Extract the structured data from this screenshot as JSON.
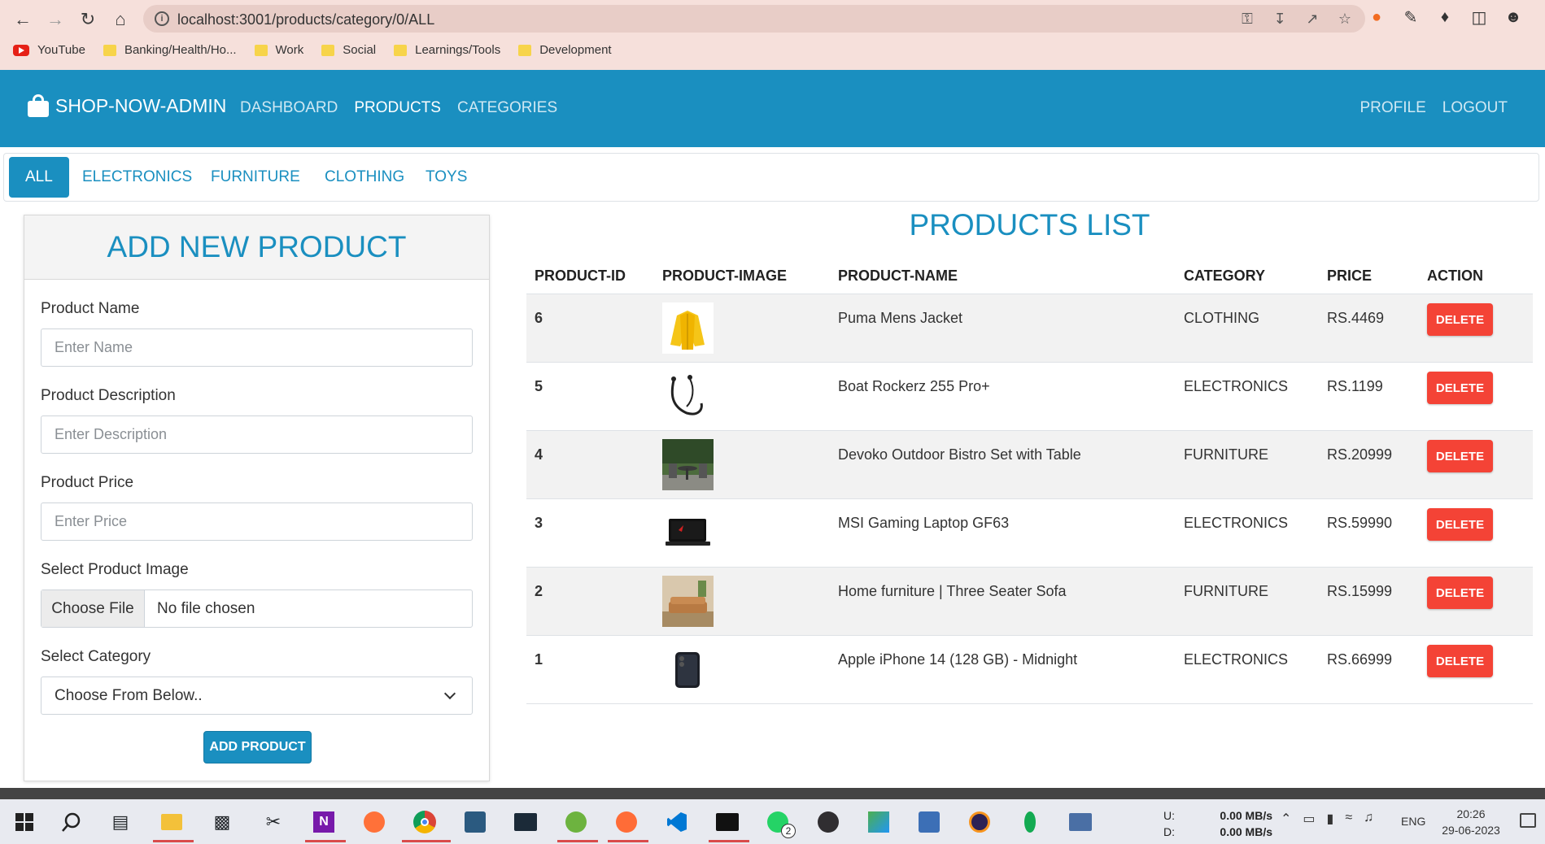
{
  "browser": {
    "url": "localhost:3001/products/category/0/ALL",
    "bookmarks": [
      {
        "label": "YouTube",
        "icon": "youtube-icon"
      },
      {
        "label": "Banking/Health/Ho...",
        "icon": "folder-icon"
      },
      {
        "label": "Work",
        "icon": "folder-icon"
      },
      {
        "label": "Social",
        "icon": "folder-icon"
      },
      {
        "label": "Learnings/Tools",
        "icon": "folder-icon"
      },
      {
        "label": "Development",
        "icon": "folder-icon"
      }
    ]
  },
  "navbar": {
    "brand": "SHOP-NOW-ADMIN",
    "links": [
      "DASHBOARD",
      "PRODUCTS",
      "CATEGORIES"
    ],
    "active_link": "PRODUCTS",
    "right_links": [
      "PROFILE",
      "LOGOUT"
    ]
  },
  "tabs": [
    "ALL",
    "ELECTRONICS",
    "FURNITURE",
    "CLOTHING",
    "TOYS"
  ],
  "form": {
    "title": "ADD NEW PRODUCT",
    "name_label": "Product Name",
    "name_placeholder": "Enter Name",
    "desc_label": "Product Description",
    "desc_placeholder": "Enter Description",
    "price_label": "Product Price",
    "price_placeholder": "Enter Price",
    "image_label": "Select Product Image",
    "file_button": "Choose File",
    "file_status": "No file chosen",
    "category_label": "Select Category",
    "category_selected": "Choose From Below..",
    "submit": "ADD PRODUCT"
  },
  "products": {
    "title": "PRODUCTS LIST",
    "columns": [
      "PRODUCT-ID",
      "PRODUCT-IMAGE",
      "PRODUCT-NAME",
      "CATEGORY",
      "PRICE",
      "ACTION"
    ],
    "rows": [
      {
        "id": "6",
        "name": "Puma Mens Jacket",
        "category": "CLOTHING",
        "price": "RS.4469",
        "action": "DELETE"
      },
      {
        "id": "5",
        "name": "Boat Rockerz 255 Pro+",
        "category": "ELECTRONICS",
        "price": "RS.1199",
        "action": "DELETE"
      },
      {
        "id": "4",
        "name": "Devoko Outdoor Bistro Set with Table",
        "category": "FURNITURE",
        "price": "RS.20999",
        "action": "DELETE"
      },
      {
        "id": "3",
        "name": "MSI Gaming Laptop GF63",
        "category": "ELECTRONICS",
        "price": "RS.59990",
        "action": "DELETE"
      },
      {
        "id": "2",
        "name": "Home furniture | Three Seater Sofa",
        "category": "FURNITURE",
        "price": "RS.15999",
        "action": "DELETE"
      },
      {
        "id": "1",
        "name": "Apple iPhone 14 (128 GB) - Midnight",
        "category": "ELECTRONICS",
        "price": "RS.66999",
        "action": "DELETE"
      }
    ]
  },
  "taskbar": {
    "net_labels": [
      "U:",
      "D:"
    ],
    "net_values": [
      "0.00 MB/s",
      "0.00 MB/s"
    ],
    "language": "ENG",
    "time": "20:26",
    "date": "29-06-2023",
    "whatsapp_badge": "2"
  },
  "colors": {
    "primary": "#1a8fc0",
    "danger": "#f44336",
    "browser_chrome": "#f6e0db"
  }
}
